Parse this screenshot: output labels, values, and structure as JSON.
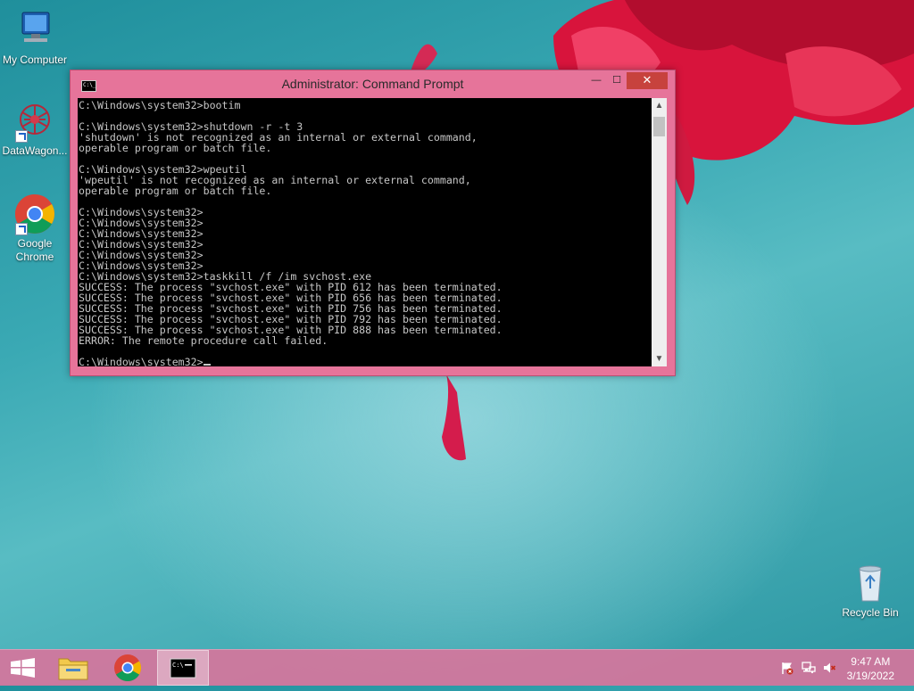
{
  "desktop": {
    "icons": [
      {
        "label": "My Computer",
        "icon": "computer-icon"
      },
      {
        "label": "DataWagon...",
        "icon": "datawagon-icon"
      },
      {
        "label": "Google Chrome",
        "icon": "chrome-icon"
      },
      {
        "label": "Recycle Bin",
        "icon": "recycle-bin-icon"
      }
    ]
  },
  "window": {
    "title": "Administrator: Command Prompt",
    "icon_glyph": "C:\\_",
    "minimize_glyph": "—",
    "maximize_glyph": "☐",
    "close_glyph": "✕",
    "lines": [
      "C:\\Windows\\system32>bootim",
      "",
      "C:\\Windows\\system32>shutdown -r -t 3",
      "'shutdown' is not recognized as an internal or external command,",
      "operable program or batch file.",
      "",
      "C:\\Windows\\system32>wpeutil",
      "'wpeutil' is not recognized as an internal or external command,",
      "operable program or batch file.",
      "",
      "C:\\Windows\\system32>",
      "C:\\Windows\\system32>",
      "C:\\Windows\\system32>",
      "C:\\Windows\\system32>",
      "C:\\Windows\\system32>",
      "C:\\Windows\\system32>",
      "C:\\Windows\\system32>taskkill /f /im svchost.exe",
      "SUCCESS: The process \"svchost.exe\" with PID 612 has been terminated.",
      "SUCCESS: The process \"svchost.exe\" with PID 656 has been terminated.",
      "SUCCESS: The process \"svchost.exe\" with PID 756 has been terminated.",
      "SUCCESS: The process \"svchost.exe\" with PID 792 has been terminated.",
      "SUCCESS: The process \"svchost.exe\" with PID 888 has been terminated.",
      "ERROR: The remote procedure call failed.",
      ""
    ],
    "prompt": "C:\\Windows\\system32>"
  },
  "taskbar": {
    "buttons": [
      {
        "name": "start-button",
        "icon": "windows-logo-icon"
      },
      {
        "name": "file-explorer-button",
        "icon": "folder-icon"
      },
      {
        "name": "chrome-taskbar-button",
        "icon": "chrome-icon"
      },
      {
        "name": "cmd-taskbar-button",
        "icon": "cmd-icon",
        "active": true
      }
    ],
    "tray": [
      "action-center-flag-icon",
      "network-icon",
      "volume-muted-icon"
    ],
    "time": "9:47 AM",
    "date": "3/19/2022"
  },
  "colors": {
    "window_frame": "#e6749a",
    "close_button": "#c7423d",
    "console_bg": "#000000",
    "console_text": "#c6c6c6",
    "taskbar": "#d6759c"
  }
}
